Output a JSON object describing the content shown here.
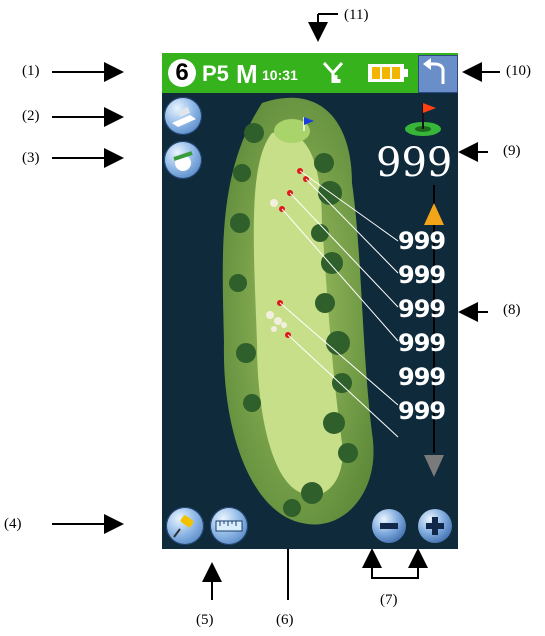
{
  "callouts": [
    "(1)",
    "(2)",
    "(3)",
    "(4)",
    "(5)",
    "(6)",
    "(7)",
    "(8)",
    "(9)",
    "(10)",
    "(11)"
  ],
  "status_bar": {
    "hole_number": "6",
    "par": "P5",
    "mode": "M",
    "time": "10:31"
  },
  "target_distance": "999",
  "hazard_distances": [
    "999",
    "999",
    "999",
    "999",
    "999",
    "999"
  ],
  "icons": {
    "signal": "antenna-icon",
    "battery": "battery-icon",
    "back": "back-arrow-icon",
    "flag_target": "green-flag-icon",
    "pin": "pin-flag-icon"
  },
  "colors": {
    "status_bar": "#35b21c",
    "screen_bg": "#0f2a3a",
    "fairway": "#c8df8a",
    "hazard_marker": "#e0161a",
    "bunker": "#f2efe0"
  }
}
